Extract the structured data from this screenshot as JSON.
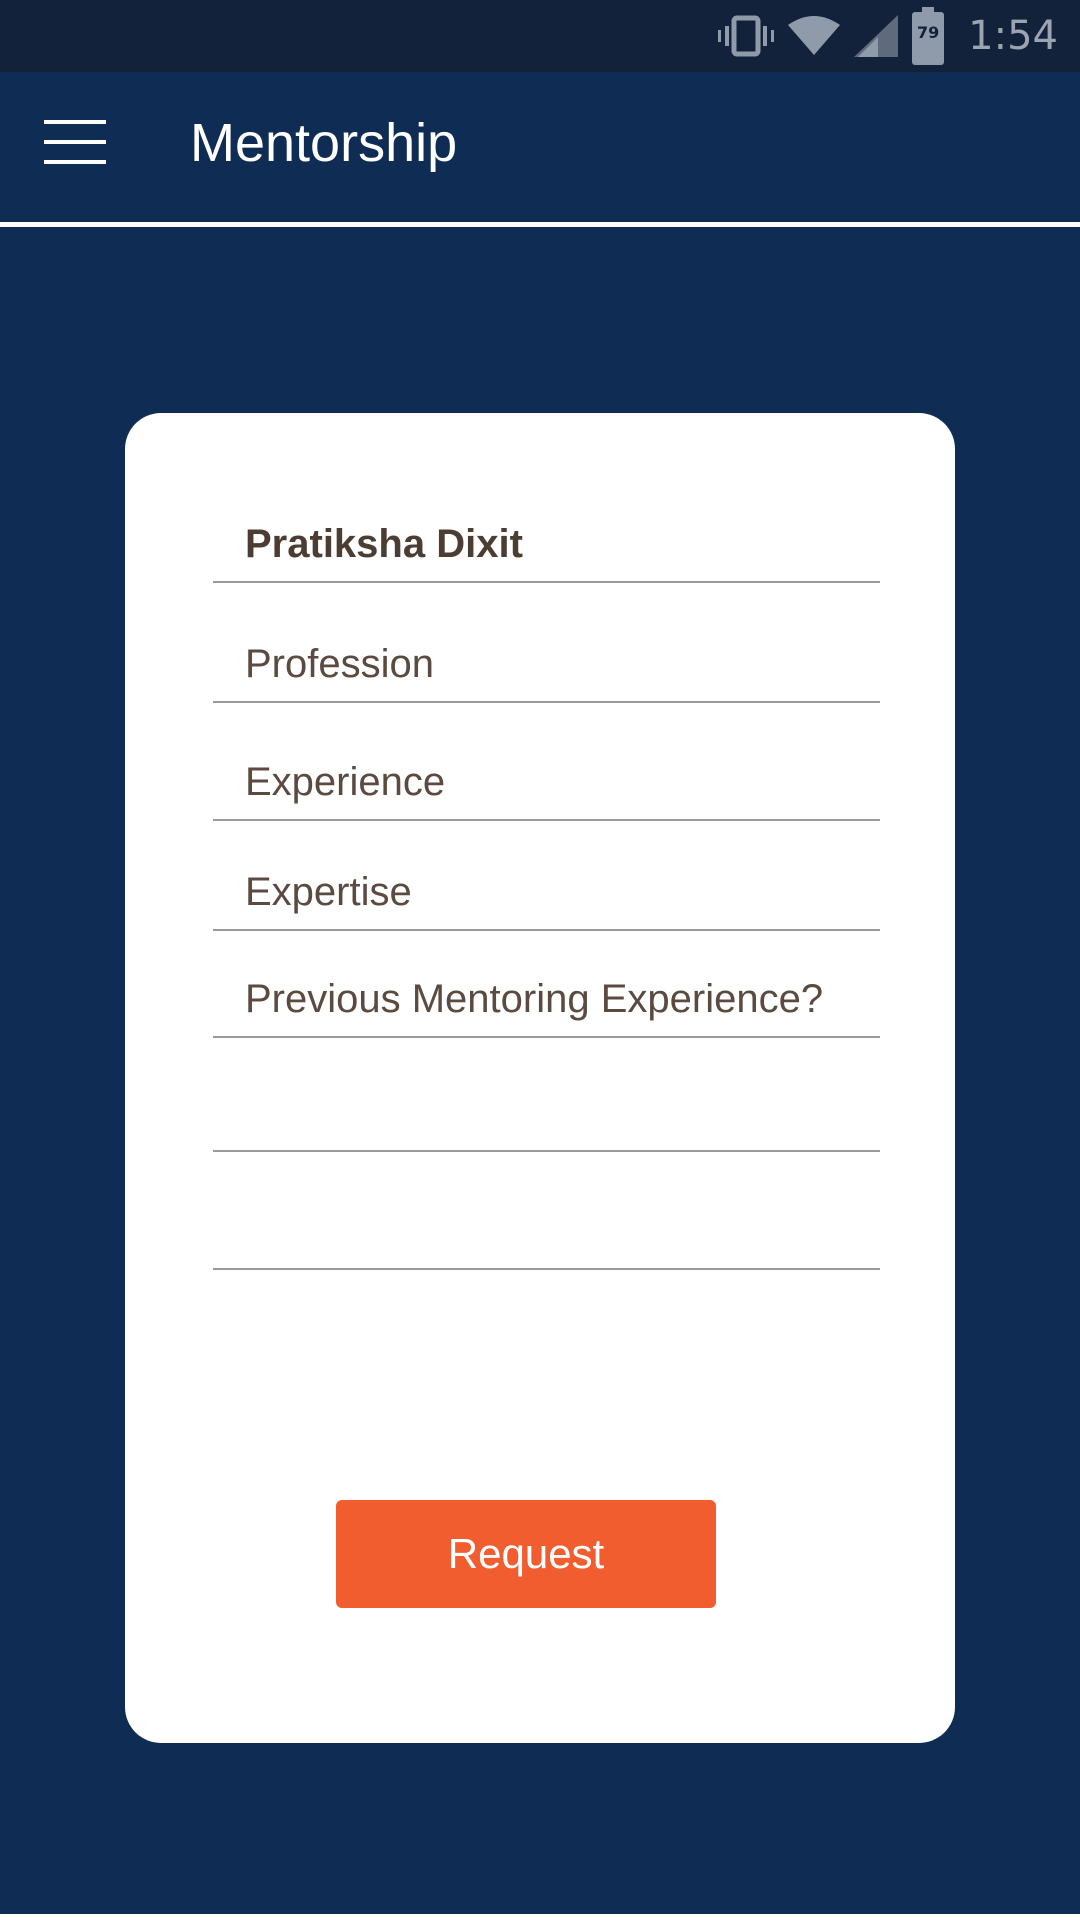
{
  "status_bar": {
    "time": "1:54",
    "battery_level": "79",
    "icons": [
      "vibrate-icon",
      "wifi-icon",
      "cell-signal-icon",
      "battery-icon"
    ]
  },
  "app_bar": {
    "title": "Mentorship",
    "menu_icon": "hamburger-menu-icon"
  },
  "form": {
    "name_value": "Pratiksha Dixit",
    "profession_placeholder": "Profession",
    "experience_placeholder": "Experience",
    "expertise_placeholder": "Expertise",
    "previous_mentoring_placeholder": "Previous Mentoring Experience?",
    "extra_field_1_value": "",
    "extra_field_2_value": ""
  },
  "actions": {
    "request_label": "Request"
  },
  "colors": {
    "background": "#0f2d54",
    "status_bar": "#13223b",
    "card": "#ffffff",
    "accent_button": "#f15d2f",
    "field_text": "#5b4a40"
  }
}
